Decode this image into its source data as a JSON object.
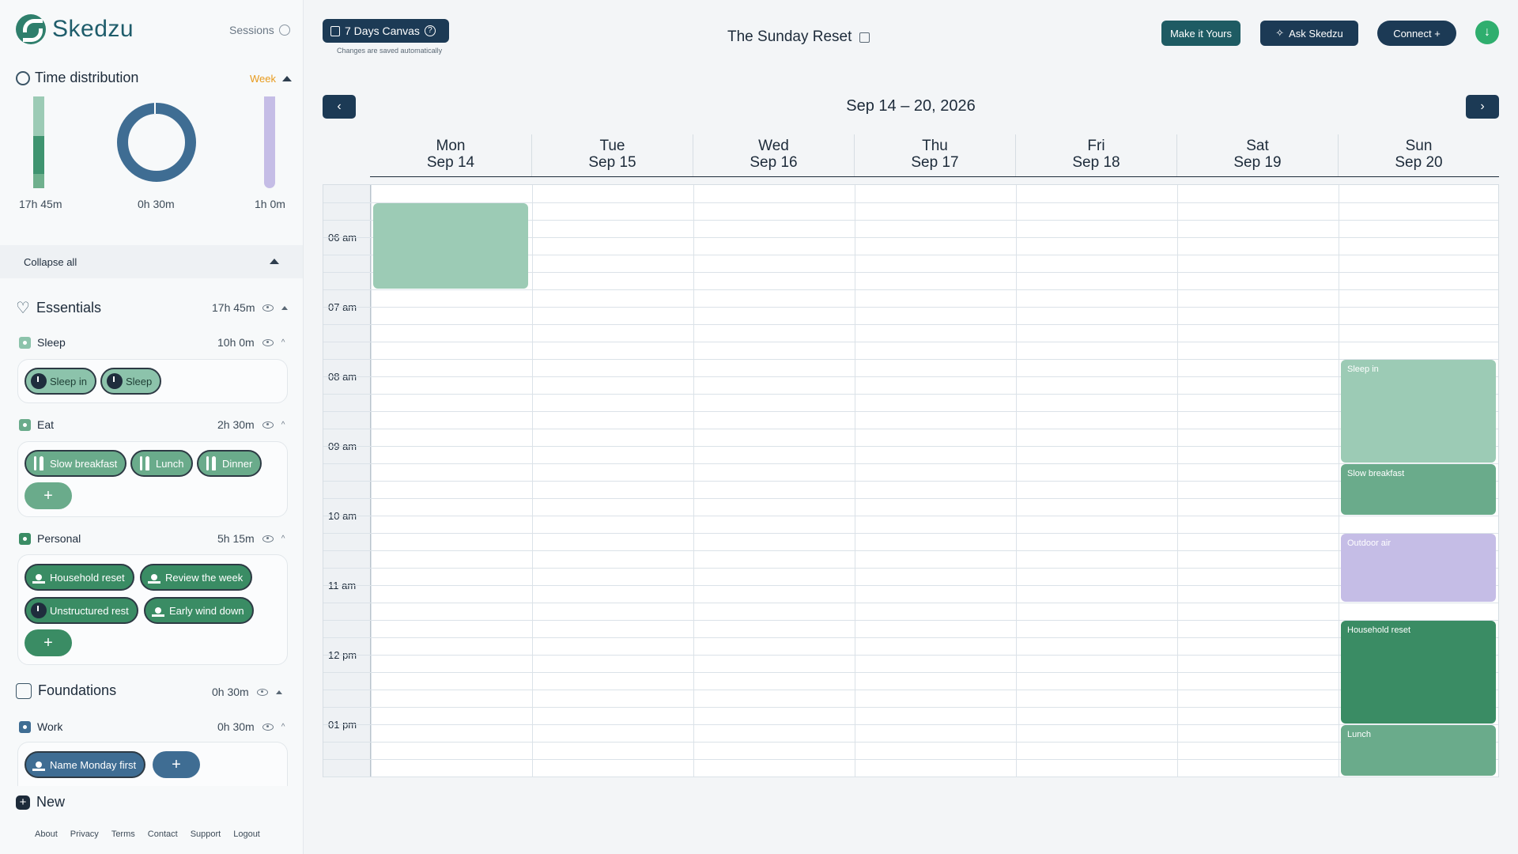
{
  "app": {
    "name": "Skedzu",
    "sessions_label": "Sessions"
  },
  "time_distribution": {
    "title": "Time distribution",
    "period": "Week",
    "essentials_total": "17h 45m",
    "foundations_total": "0h 30m",
    "other_total": "1h 0m"
  },
  "collapse_all": "Collapse all",
  "sections": {
    "essentials": {
      "title": "Essentials",
      "duration": "17h 45m"
    },
    "foundations": {
      "title": "Foundations",
      "duration": "0h 30m"
    }
  },
  "categories": {
    "sleep": {
      "name": "Sleep",
      "duration": "10h 0m",
      "color": "#8cc3ab",
      "chips": [
        "Sleep in",
        "Sleep"
      ]
    },
    "eat": {
      "name": "Eat",
      "duration": "2h 30m",
      "color": "#6aab8b",
      "chips": [
        "Slow breakfast",
        "Lunch",
        "Dinner"
      ]
    },
    "personal": {
      "name": "Personal",
      "duration": "5h 15m",
      "color": "#3a8c64",
      "chips": [
        "Household reset",
        "Review the week",
        "Unstructured rest",
        "Early wind down"
      ]
    },
    "work": {
      "name": "Work",
      "duration": "0h 30m",
      "color": "#3f6d93",
      "chips": [
        "Name Monday first"
      ]
    }
  },
  "add_symbol": "+",
  "new_label": "New",
  "footer": [
    "About",
    "Privacy",
    "Terms",
    "Contact",
    "Support",
    "Logout"
  ],
  "toolbar": {
    "canvas_label": "7 Days Canvas",
    "canvas_sub": "Changes are saved automatically",
    "title": "The Sunday Reset",
    "make_it_yours": "Make it Yours",
    "ask": "Ask Skedzu",
    "connect": "Connect +"
  },
  "calendar": {
    "range": "Sep 14 – 20, 2026",
    "days": [
      {
        "dow": "Mon",
        "date": "Sep 14"
      },
      {
        "dow": "Tue",
        "date": "Sep 15"
      },
      {
        "dow": "Wed",
        "date": "Sep 16"
      },
      {
        "dow": "Thu",
        "date": "Sep 17"
      },
      {
        "dow": "Fri",
        "date": "Sep 18"
      },
      {
        "dow": "Sat",
        "date": "Sep 19"
      },
      {
        "dow": "Sun",
        "date": "Sep 20"
      }
    ],
    "hours": [
      "06",
      "07",
      "08",
      "09",
      "10",
      "11",
      "12",
      "01"
    ],
    "hour_suffix": [
      "am",
      "am",
      "am",
      "am",
      "am",
      "am",
      "pm",
      "pm"
    ],
    "events": [
      {
        "day": 0,
        "title": "",
        "start": "05:30",
        "end": "06:45",
        "color": "#9ccbb5"
      },
      {
        "day": 6,
        "title": "Sleep in",
        "start": "07:45",
        "end": "09:15",
        "color": "#9ccbb5"
      },
      {
        "day": 6,
        "title": "Slow breakfast",
        "start": "09:15",
        "end": "10:00",
        "color": "#6aab8b"
      },
      {
        "day": 6,
        "title": "Outdoor air",
        "start": "10:15",
        "end": "11:15",
        "color": "#c5bde6"
      },
      {
        "day": 6,
        "title": "Household reset",
        "start": "11:30",
        "end": "13:00",
        "color": "#3a8c64"
      },
      {
        "day": 6,
        "title": "Lunch",
        "start": "13:00",
        "end": "13:45",
        "color": "#6aab8b"
      }
    ]
  }
}
